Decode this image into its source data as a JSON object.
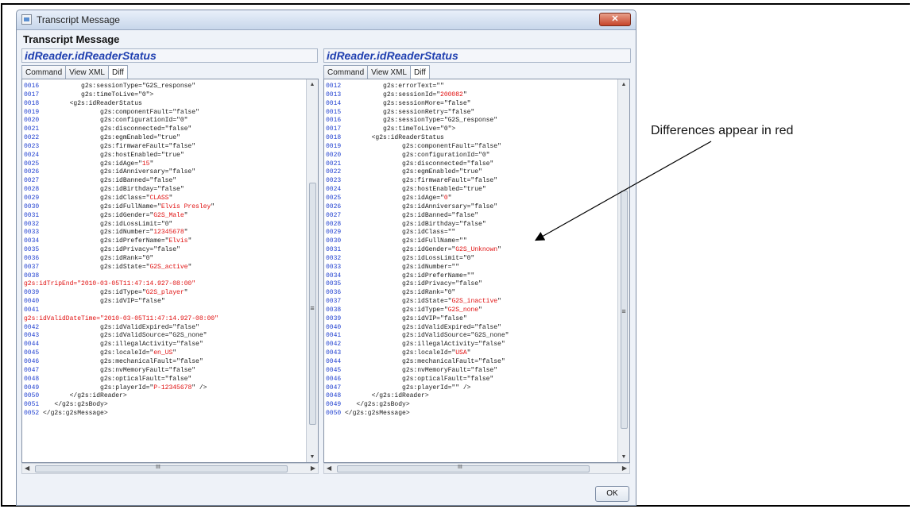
{
  "window": {
    "title": "Transcript Message",
    "close_label": "✕"
  },
  "header": "Transcript Message",
  "left_pane": {
    "title": "idReader.idReaderStatus",
    "tabs": [
      "Command",
      "View XML",
      "Diff"
    ],
    "active_tab": "Diff",
    "lines": [
      [
        [
          "ln",
          "0016"
        ],
        [
          "",
          "           g2s:sessionType=\"G2S_response\""
        ]
      ],
      [
        [
          "ln",
          "0017"
        ],
        [
          "",
          "           g2s:timeToLive=\"0\">"
        ]
      ],
      [
        [
          "ln",
          "0018"
        ],
        [
          "",
          "        <g2s:idReaderStatus"
        ]
      ],
      [
        [
          "ln",
          "0019"
        ],
        [
          "",
          "                g2s:componentFault=\"false\""
        ]
      ],
      [
        [
          "ln",
          "0020"
        ],
        [
          "",
          "                g2s:configurationId=\"0\""
        ]
      ],
      [
        [
          "ln",
          "0021"
        ],
        [
          "",
          "                g2s:disconnected=\"false\""
        ]
      ],
      [
        [
          "ln",
          "0022"
        ],
        [
          "",
          "                g2s:egmEnabled=\"true\""
        ]
      ],
      [
        [
          "ln",
          "0023"
        ],
        [
          "",
          "                g2s:firmwareFault=\"false\""
        ]
      ],
      [
        [
          "ln",
          "0024"
        ],
        [
          "",
          "                g2s:hostEnabled=\"true\""
        ]
      ],
      [
        [
          "ln",
          "0025"
        ],
        [
          "",
          "                g2s:idAge=\""
        ],
        [
          "red",
          "15"
        ],
        [
          "",
          "\""
        ]
      ],
      [
        [
          "ln",
          "0026"
        ],
        [
          "",
          "                g2s:idAnniversary=\"false\""
        ]
      ],
      [
        [
          "ln",
          "0027"
        ],
        [
          "",
          "                g2s:idBanned=\"false\""
        ]
      ],
      [
        [
          "ln",
          "0028"
        ],
        [
          "",
          "                g2s:idBirthday=\"false\""
        ]
      ],
      [
        [
          "ln",
          "0029"
        ],
        [
          "",
          "                g2s:idClass=\""
        ],
        [
          "red",
          "CLASS"
        ],
        [
          "",
          "\""
        ]
      ],
      [
        [
          "ln",
          "0030"
        ],
        [
          "",
          "                g2s:idFullName=\""
        ],
        [
          "red",
          "Elvis Presley"
        ],
        [
          "",
          "\""
        ]
      ],
      [
        [
          "ln",
          "0031"
        ],
        [
          "",
          "                g2s:idGender=\""
        ],
        [
          "red",
          "G2S_Male"
        ],
        [
          "",
          "\""
        ]
      ],
      [
        [
          "ln",
          "0032"
        ],
        [
          "",
          "                g2s:idLossLimit=\"0\""
        ]
      ],
      [
        [
          "ln",
          "0033"
        ],
        [
          "",
          "                g2s:idNumber=\""
        ],
        [
          "red",
          "12345678"
        ],
        [
          "",
          "\""
        ]
      ],
      [
        [
          "ln",
          "0034"
        ],
        [
          "",
          "                g2s:idPreferName=\""
        ],
        [
          "red",
          "Elvis"
        ],
        [
          "",
          "\""
        ]
      ],
      [
        [
          "ln",
          "0035"
        ],
        [
          "",
          "                g2s:idPrivacy=\"false\""
        ]
      ],
      [
        [
          "ln",
          "0036"
        ],
        [
          "",
          "                g2s:idRank=\"0\""
        ]
      ],
      [
        [
          "ln",
          "0037"
        ],
        [
          "",
          "                g2s:idState=\""
        ],
        [
          "red",
          "G2S_active"
        ],
        [
          "",
          "\""
        ]
      ],
      [
        [
          "ln",
          "0038"
        ]
      ],
      [
        [
          "red",
          "g2s:idTripEnd=\"2010-03-05T11:47:14.927-08:00\""
        ]
      ],
      [
        [
          "ln",
          "0039"
        ],
        [
          "",
          "                g2s:idType=\""
        ],
        [
          "red",
          "G2S_player"
        ],
        [
          "",
          "\""
        ]
      ],
      [
        [
          "ln",
          "0040"
        ],
        [
          "",
          "                g2s:idVIP=\"false\""
        ]
      ],
      [
        [
          "ln",
          "0041"
        ]
      ],
      [
        [
          "red",
          "g2s:idValidDateTime=\"2010-03-05T11:47:14.927-08:00\""
        ]
      ],
      [
        [
          "ln",
          "0042"
        ],
        [
          "",
          "                g2s:idValidExpired=\"false\""
        ]
      ],
      [
        [
          "ln",
          "0043"
        ],
        [
          "",
          "                g2s:idValidSource=\"G2S_none\""
        ]
      ],
      [
        [
          "ln",
          "0044"
        ],
        [
          "",
          "                g2s:illegalActivity=\"false\""
        ]
      ],
      [
        [
          "ln",
          "0045"
        ],
        [
          "",
          "                g2s:localeId=\""
        ],
        [
          "red",
          "en_US"
        ],
        [
          "",
          "\""
        ]
      ],
      [
        [
          "ln",
          "0046"
        ],
        [
          "",
          "                g2s:mechanicalFault=\"false\""
        ]
      ],
      [
        [
          "ln",
          "0047"
        ],
        [
          "",
          "                g2s:nvMemoryFault=\"false\""
        ]
      ],
      [
        [
          "ln",
          "0048"
        ],
        [
          "",
          "                g2s:opticalFault=\"false\""
        ]
      ],
      [
        [
          "ln",
          "0049"
        ],
        [
          "",
          "                g2s:playerId=\""
        ],
        [
          "red",
          "P-12345678"
        ],
        [
          "",
          "\" />"
        ]
      ],
      [
        [
          "ln",
          "0050"
        ],
        [
          "",
          "        </g2s:idReader>"
        ]
      ],
      [
        [
          "ln",
          "0051"
        ],
        [
          "",
          "    </g2s:g2sBody>"
        ]
      ],
      [
        [
          "ln",
          "0052"
        ],
        [
          "",
          " </g2s:g2sMessage>"
        ]
      ]
    ]
  },
  "right_pane": {
    "title": "idReader.idReaderStatus",
    "tabs": [
      "Command",
      "View XML",
      "Diff"
    ],
    "active_tab": "Diff",
    "lines": [
      [
        [
          "ln",
          "0012"
        ],
        [
          "",
          "           g2s:errorText=\"\""
        ]
      ],
      [
        [
          "ln",
          "0013"
        ],
        [
          "",
          "           g2s:sessionId=\""
        ],
        [
          "red",
          "200082"
        ],
        [
          "",
          "\""
        ]
      ],
      [
        [
          "ln",
          "0014"
        ],
        [
          "",
          "           g2s:sessionMore=\"false\""
        ]
      ],
      [
        [
          "ln",
          "0015"
        ],
        [
          "",
          "           g2s:sessionRetry=\"false\""
        ]
      ],
      [
        [
          "ln",
          "0016"
        ],
        [
          "",
          "           g2s:sessionType=\"G2S_response\""
        ]
      ],
      [
        [
          "ln",
          "0017"
        ],
        [
          "",
          "           g2s:timeToLive=\"0\">"
        ]
      ],
      [
        [
          "ln",
          "0018"
        ],
        [
          "",
          "        <g2s:idReaderStatus"
        ]
      ],
      [
        [
          "ln",
          "0019"
        ],
        [
          "",
          "                g2s:componentFault=\"false\""
        ]
      ],
      [
        [
          "ln",
          "0020"
        ],
        [
          "",
          "                g2s:configurationId=\"0\""
        ]
      ],
      [
        [
          "ln",
          "0021"
        ],
        [
          "",
          "                g2s:disconnected=\"false\""
        ]
      ],
      [
        [
          "ln",
          "0022"
        ],
        [
          "",
          "                g2s:egmEnabled=\"true\""
        ]
      ],
      [
        [
          "ln",
          "0023"
        ],
        [
          "",
          "                g2s:firmwareFault=\"false\""
        ]
      ],
      [
        [
          "ln",
          "0024"
        ],
        [
          "",
          "                g2s:hostEnabled=\"true\""
        ]
      ],
      [
        [
          "ln",
          "0025"
        ],
        [
          "",
          "                g2s:idAge=\""
        ],
        [
          "red",
          "0"
        ],
        [
          "",
          "\""
        ]
      ],
      [
        [
          "ln",
          "0026"
        ],
        [
          "",
          "                g2s:idAnniversary=\"false\""
        ]
      ],
      [
        [
          "ln",
          "0027"
        ],
        [
          "",
          "                g2s:idBanned=\"false\""
        ]
      ],
      [
        [
          "ln",
          "0028"
        ],
        [
          "",
          "                g2s:idBirthday=\"false\""
        ]
      ],
      [
        [
          "ln",
          "0029"
        ],
        [
          "",
          "                g2s:idClass=\"\""
        ]
      ],
      [
        [
          "ln",
          "0030"
        ],
        [
          "",
          "                g2s:idFullName=\"\""
        ]
      ],
      [
        [
          "ln",
          "0031"
        ],
        [
          "",
          "                g2s:idGender=\""
        ],
        [
          "red",
          "G2S_Unknown"
        ],
        [
          "",
          "\""
        ]
      ],
      [
        [
          "ln",
          "0032"
        ],
        [
          "",
          "                g2s:idLossLimit=\"0\""
        ]
      ],
      [
        [
          "ln",
          "0033"
        ],
        [
          "",
          "                g2s:idNumber=\"\""
        ]
      ],
      [
        [
          "ln",
          "0034"
        ],
        [
          "",
          "                g2s:idPreferName=\"\""
        ]
      ],
      [
        [
          "ln",
          "0035"
        ],
        [
          "",
          "                g2s:idPrivacy=\"false\""
        ]
      ],
      [
        [
          "ln",
          "0036"
        ],
        [
          "",
          "                g2s:idRank=\"0\""
        ]
      ],
      [
        [
          "ln",
          "0037"
        ],
        [
          "",
          "                g2s:idState=\""
        ],
        [
          "red",
          "G2S_inactive"
        ],
        [
          "",
          "\""
        ]
      ],
      [
        [
          "ln",
          "0038"
        ],
        [
          "",
          "                g2s:idType=\""
        ],
        [
          "red",
          "G2S_none"
        ],
        [
          "",
          "\""
        ]
      ],
      [
        [
          "ln",
          "0039"
        ],
        [
          "",
          "                g2s:idVIP=\"false\""
        ]
      ],
      [
        [
          "ln",
          "0040"
        ],
        [
          "",
          "                g2s:idValidExpired=\"false\""
        ]
      ],
      [
        [
          "ln",
          "0041"
        ],
        [
          "",
          "                g2s:idValidSource=\"G2S_none\""
        ]
      ],
      [
        [
          "ln",
          "0042"
        ],
        [
          "",
          "                g2s:illegalActivity=\"false\""
        ]
      ],
      [
        [
          "ln",
          "0043"
        ],
        [
          "",
          "                g2s:localeId=\""
        ],
        [
          "red",
          "USA"
        ],
        [
          "",
          "\""
        ]
      ],
      [
        [
          "ln",
          "0044"
        ],
        [
          "",
          "                g2s:mechanicalFault=\"false\""
        ]
      ],
      [
        [
          "ln",
          "0045"
        ],
        [
          "",
          "                g2s:nvMemoryFault=\"false\""
        ]
      ],
      [
        [
          "ln",
          "0046"
        ],
        [
          "",
          "                g2s:opticalFault=\"false\""
        ]
      ],
      [
        [
          "ln",
          "0047"
        ],
        [
          "",
          "                g2s:playerId=\"\" />"
        ]
      ],
      [
        [
          "ln",
          "0048"
        ],
        [
          "",
          "        </g2s:idReader>"
        ]
      ],
      [
        [
          "ln",
          "0049"
        ],
        [
          "",
          "    </g2s:g2sBody>"
        ]
      ],
      [
        [
          "ln",
          "0050"
        ],
        [
          "",
          " </g2s:g2sMessage>"
        ]
      ]
    ]
  },
  "scroll_thumb_label": "≡",
  "hscroll_grip": "III",
  "ok_label": "OK",
  "annotation": "Differences appear in red"
}
